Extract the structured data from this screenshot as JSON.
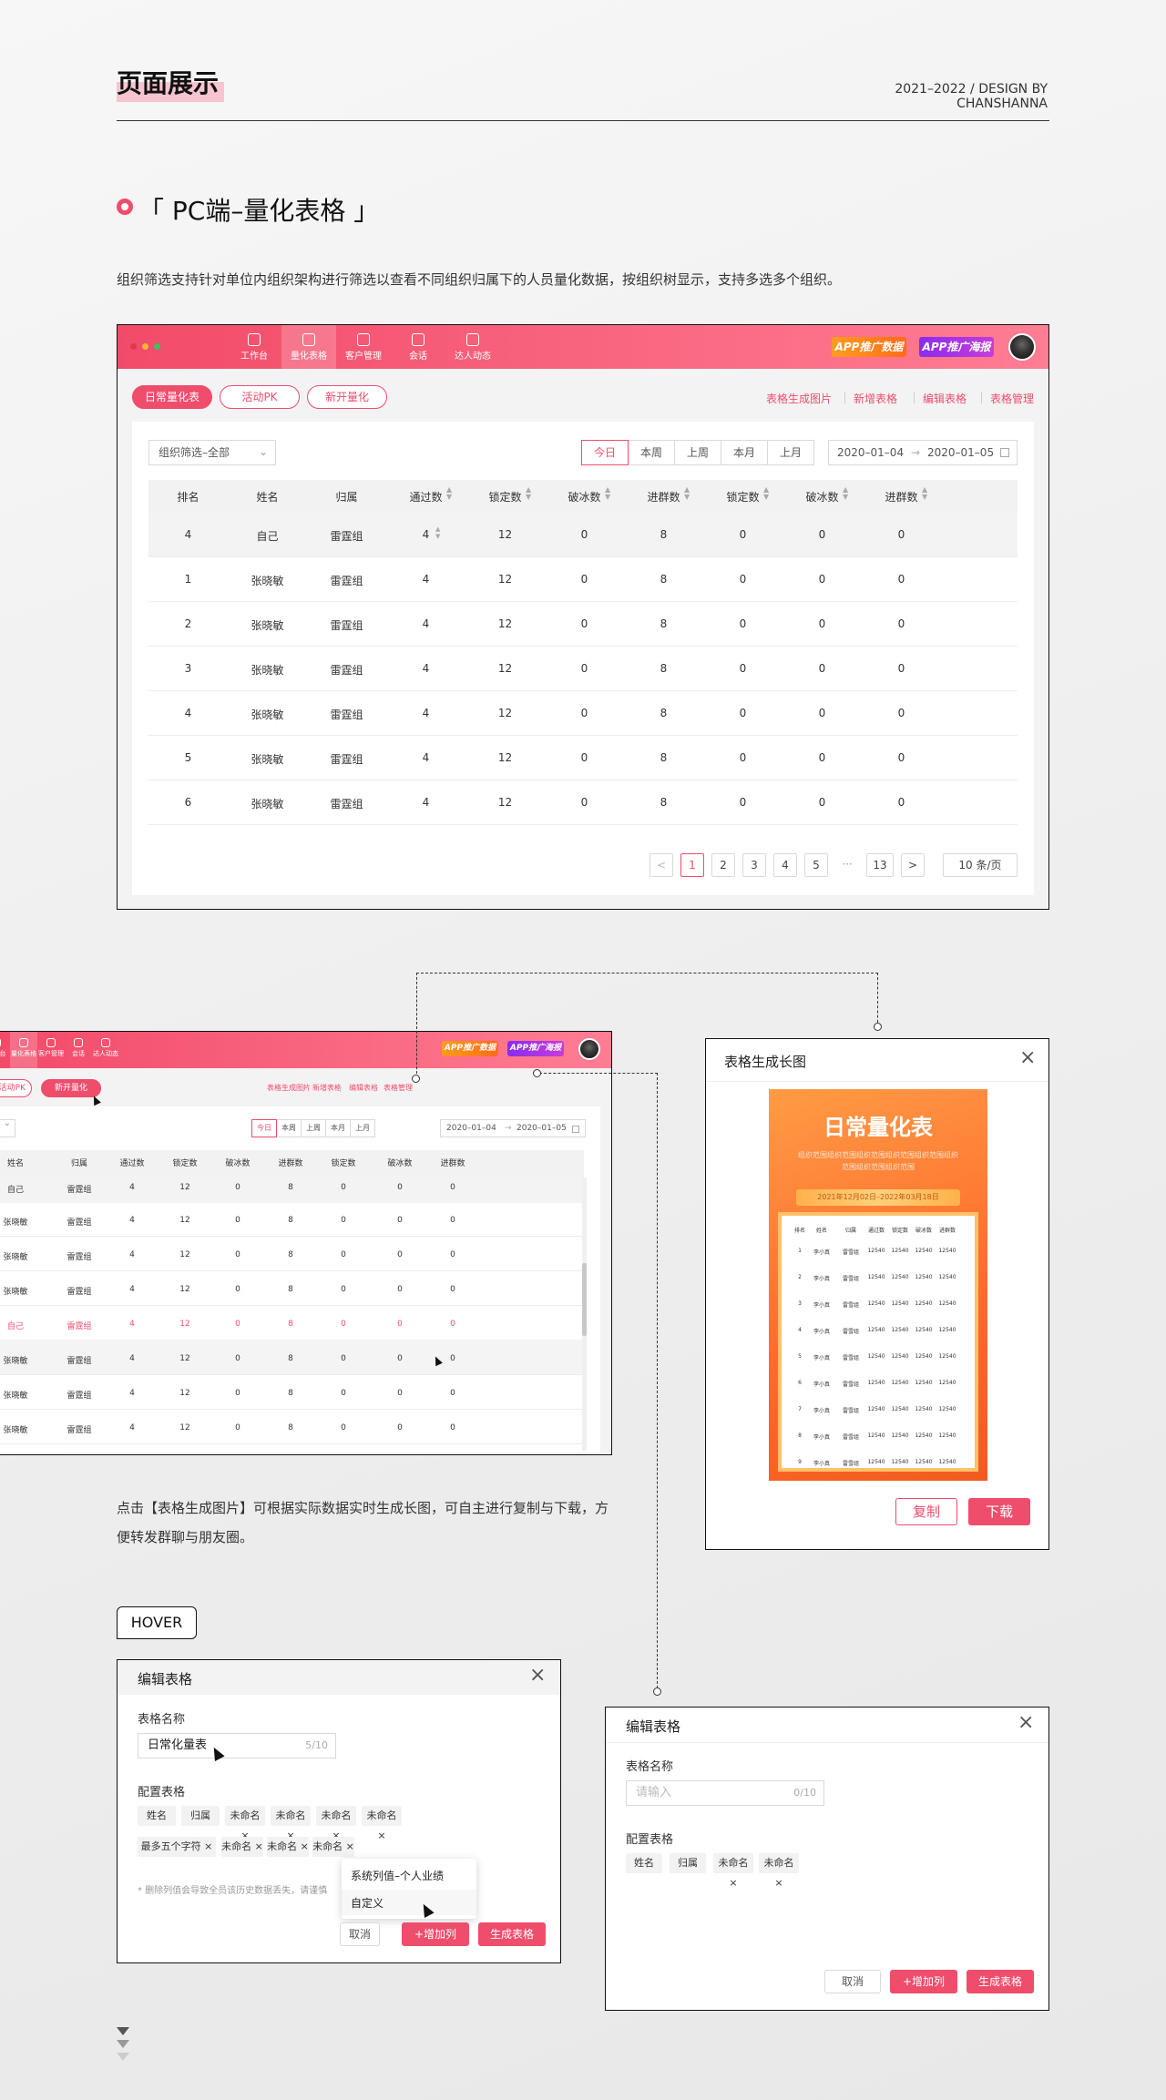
{
  "header": {
    "title": "页面展示",
    "credit": "2021–2022 / DESIGN BY CHANSHANNA"
  },
  "section": {
    "title": "「 PC端–量化表格 」",
    "description": "组织筛选支持针对单位内组织架构进行筛选以查看不同组织归属下的人员量化数据，按组织树显示，支持多选多个组织。"
  },
  "app": {
    "nav": [
      {
        "label": "工作台",
        "icon": "grid-icon"
      },
      {
        "label": "量化表格",
        "icon": "bar-chart-icon"
      },
      {
        "label": "客户管理",
        "icon": "users-icon"
      },
      {
        "label": "会话",
        "icon": "chat-icon"
      },
      {
        "label": "达人动态",
        "icon": "compass-icon"
      }
    ],
    "chips": [
      "APP推广数据",
      "APP推广海报"
    ],
    "tabs": [
      "日常量化表",
      "活动PK",
      "新开量化"
    ],
    "links": [
      "表格生成图片",
      "新增表格",
      "编辑表格",
      "表格管理"
    ],
    "filter": "组织筛选–全部",
    "periods": [
      "今日",
      "本周",
      "上周",
      "本月",
      "上月"
    ],
    "date_start": "2020–01–04",
    "date_arrow": "→",
    "date_end": "2020–01–05",
    "columns": [
      "排名",
      "姓名",
      "归属",
      "通过数",
      "锁定数",
      "破冰数",
      "进群数",
      "锁定数",
      "破冰数",
      "进群数"
    ],
    "rows": [
      [
        "4",
        "自己",
        "雷霆组",
        "4",
        "12",
        "0",
        "8",
        "0",
        "0",
        "0"
      ],
      [
        "1",
        "张晓敏",
        "雷霆组",
        "4",
        "12",
        "0",
        "8",
        "0",
        "0",
        "0"
      ],
      [
        "2",
        "张晓敏",
        "雷霆组",
        "4",
        "12",
        "0",
        "8",
        "0",
        "0",
        "0"
      ],
      [
        "3",
        "张晓敏",
        "雷霆组",
        "4",
        "12",
        "0",
        "8",
        "0",
        "0",
        "0"
      ],
      [
        "4",
        "张晓敏",
        "雷霆组",
        "4",
        "12",
        "0",
        "8",
        "0",
        "0",
        "0"
      ],
      [
        "5",
        "张晓敏",
        "雷霆组",
        "4",
        "12",
        "0",
        "8",
        "0",
        "0",
        "0"
      ],
      [
        "6",
        "张晓敏",
        "雷霆组",
        "4",
        "12",
        "0",
        "8",
        "0",
        "0",
        "0"
      ]
    ],
    "pagination": {
      "prev": "<",
      "pages": [
        "1",
        "2",
        "3",
        "4",
        "5"
      ],
      "ellipsis": "···",
      "last": "13",
      "next": ">",
      "size": "10 条/页"
    }
  },
  "app2": {
    "tabs_partial": "活动PK",
    "rows": [
      [
        "张晓敏",
        "雷霆组",
        "4",
        "12",
        "0",
        "8",
        "0",
        "0",
        "0"
      ],
      [
        "张晓敏",
        "雷霆组",
        "4",
        "12",
        "0",
        "8",
        "0",
        "0",
        "0"
      ],
      [
        "张晓敏",
        "雷霆组",
        "4",
        "12",
        "0",
        "8",
        "0",
        "0",
        "0"
      ],
      [
        "自己",
        "雷霆组",
        "4",
        "12",
        "0",
        "8",
        "0",
        "0",
        "0"
      ],
      [
        "张晓敏",
        "雷霆组",
        "4",
        "12",
        "0",
        "8",
        "0",
        "0",
        "0"
      ],
      [
        "张晓敏",
        "雷霆组",
        "4",
        "12",
        "0",
        "8",
        "0",
        "0",
        "0"
      ],
      [
        "张晓敏",
        "雷霆组",
        "4",
        "12",
        "0",
        "8",
        "0",
        "0",
        "0"
      ]
    ],
    "first_row": [
      "自己",
      "雷霆组",
      "4",
      "12",
      "0",
      "8",
      "0",
      "0",
      "0"
    ],
    "columns": [
      "姓名",
      "归属",
      "通过数",
      "锁定数",
      "破冰数",
      "进群数",
      "锁定数",
      "破冰数",
      "进群数"
    ]
  },
  "poster_dialog": {
    "title": "表格生成长图",
    "close": "×",
    "poster_title": "日常量化表",
    "poster_sub": "组织范围组织范围组织范围组织范围组织范围组织\n范围组织范围组织范围",
    "poster_date": "2021年12月02日–2022年03月18日",
    "poster_cols": [
      "排名",
      "姓名",
      "归属",
      "通过数",
      "锁定数",
      "破冰数",
      "进群数"
    ],
    "poster_rows": [
      "1",
      "2",
      "3",
      "4",
      "5",
      "6",
      "7",
      "8",
      "9"
    ],
    "poster_name": "李小真",
    "poster_group": "雷雪组",
    "poster_value": "12540",
    "copy": "复制",
    "download": "下载"
  },
  "caption2": "点击【表格生成图片】可根据实际数据实时生成长图，可自主进行复制与下载，方便转发群聊与朋友圈。",
  "hover_badge": "HOVER",
  "edit_dialog_a": {
    "title": "编辑表格",
    "close": "×",
    "name_label": "表格名称",
    "name_value": "日常化量表",
    "name_count": "5/10",
    "config_label": "配置表格",
    "tags_row1": [
      "姓名",
      "归属",
      "未命名 ×",
      "未命名 ×",
      "未命名 ×",
      "未命名 ×"
    ],
    "tags_row2": [
      "最多五个字符 ×",
      "未命名 ×",
      "未命名 ×",
      "未命名 ×"
    ],
    "dropdown": [
      "系统列值–个人业绩",
      "自定义"
    ],
    "warning": "* 删除列值会导致全员该历史数据丢失，请谨慎",
    "cancel": "取消",
    "add": "+增加列",
    "generate": "生成表格"
  },
  "edit_dialog_b": {
    "title": "编辑表格",
    "close": "×",
    "name_label": "表格名称",
    "name_placeholder": "请输入",
    "name_count": "0/10",
    "config_label": "配置表格",
    "tags": [
      "姓名",
      "归属",
      "未命名 ×",
      "未命名 ×"
    ],
    "cancel": "取消",
    "add": "+增加列",
    "generate": "生成表格"
  },
  "colors": {
    "accent": "#ef4d6c",
    "chip_orange": "#ff7a1a",
    "chip_purple": "#a334e4",
    "poster_orange": "#ff7b2e"
  }
}
